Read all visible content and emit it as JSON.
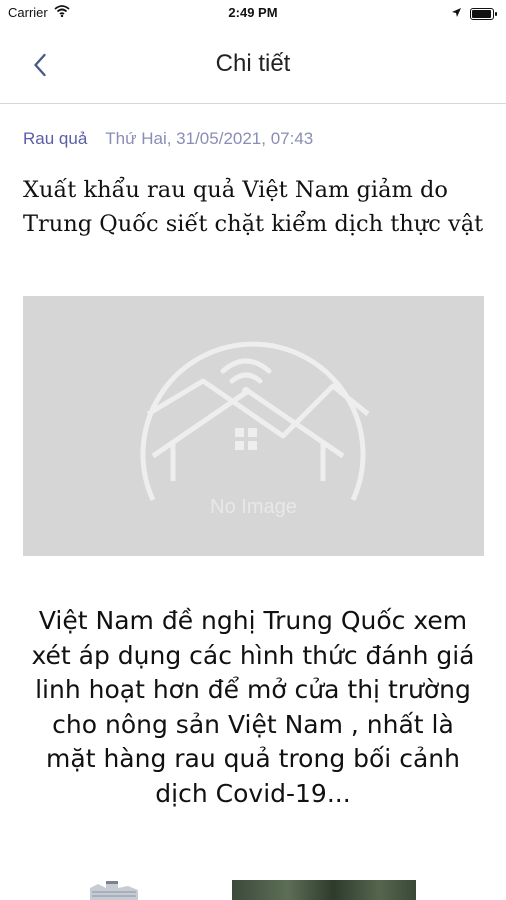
{
  "status_bar": {
    "carrier": "Carrier",
    "time": "2:49 PM",
    "battery_level": 0.95
  },
  "nav": {
    "title": "Chi tiết",
    "back_icon": "chevron-left-icon"
  },
  "article": {
    "category": "Rau quả",
    "date": "Thứ Hai, 31/05/2021, 07:43",
    "headline": "Xuất khẩu rau quả Việt Nam giảm do Trung Quốc siết chặt kiểm dịch thực vật",
    "image_placeholder_text": "No Image",
    "summary": "Việt Nam đề nghị Trung Quốc xem xét áp dụng các hình thức đánh giá linh hoạt hơn để mở cửa thị trường cho nông sản Việt Nam , nhất là mặt hàng rau quả trong bối cảnh dịch Covid-19..."
  },
  "colors": {
    "category": "#5b5ea6",
    "date": "#8a8db5",
    "placeholder_bg": "#d6d6d6"
  }
}
